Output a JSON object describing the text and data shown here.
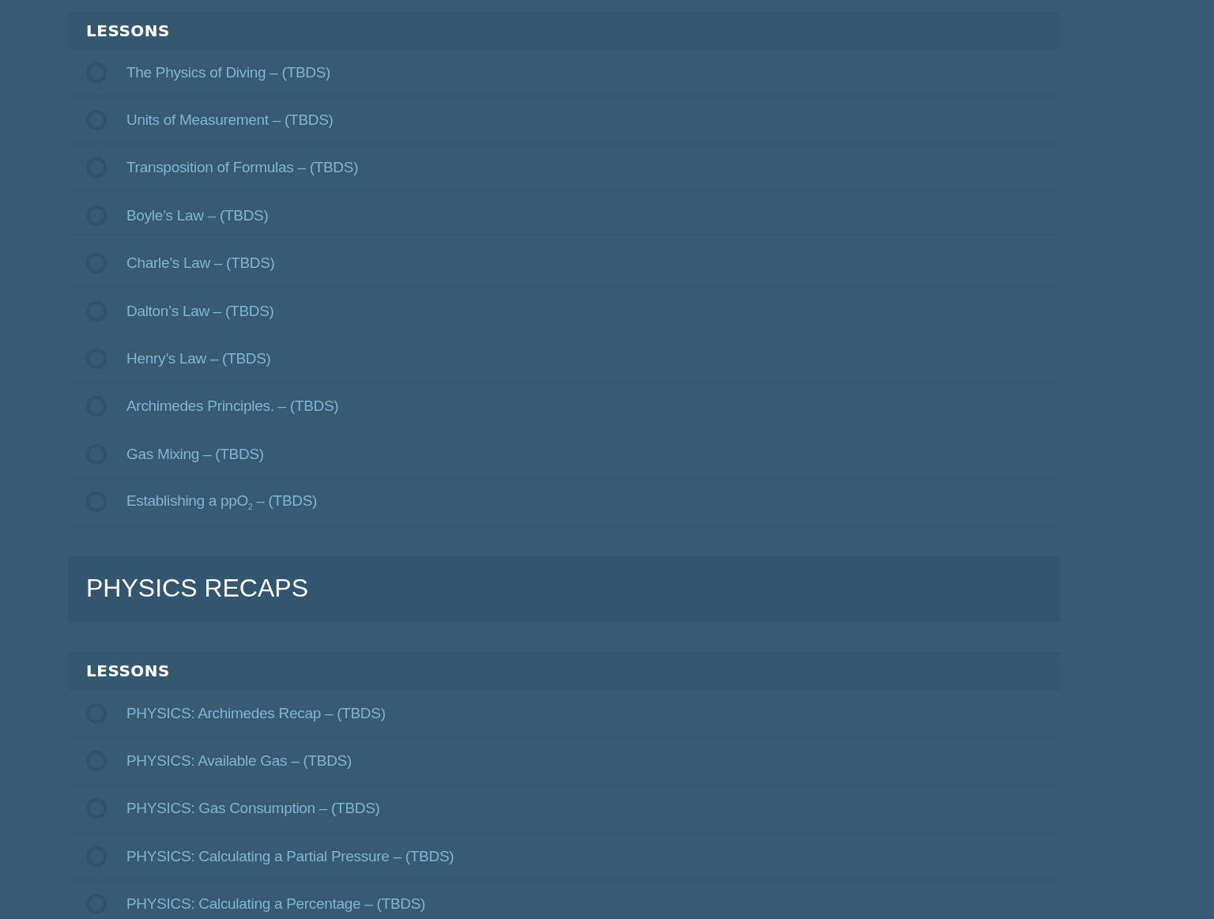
{
  "sections": [
    {
      "heading": "LESSONS",
      "lessons": [
        {
          "title": "The Physics of Diving – (TBDS)",
          "completed": false
        },
        {
          "title": "Units of Measurement – (TBDS)",
          "completed": false
        },
        {
          "title": "Transposition of Formulas – (TBDS)",
          "completed": false
        },
        {
          "title": "Boyle’s Law – (TBDS)",
          "completed": false
        },
        {
          "title": "Charle’s Law – (TBDS)",
          "completed": false
        },
        {
          "title": "Dalton’s Law – (TBDS)",
          "completed": false
        },
        {
          "title": "Henry’s Law – (TBDS)",
          "completed": false
        },
        {
          "title": "Archimedes Principles. – (TBDS)",
          "completed": false
        },
        {
          "title": "Gas Mixing – (TBDS)",
          "completed": false
        },
        {
          "title": "Establishing a ppO$_{2}$ – (TBDS)",
          "completed": false
        }
      ]
    },
    {
      "title": "PHYSICS RECAPS",
      "heading": "LESSONS",
      "lessons": [
        {
          "title": "PHYSICS: Archimedes Recap – (TBDS)",
          "completed": false
        },
        {
          "title": "PHYSICS: Available Gas – (TBDS)",
          "completed": false
        },
        {
          "title": "PHYSICS: Gas Consumption – (TBDS)",
          "completed": false
        },
        {
          "title": "PHYSICS: Calculating a Partial Pressure – (TBDS)",
          "completed": false
        },
        {
          "title": "PHYSICS: Calculating a Percentage – (TBDS)",
          "completed": false
        }
      ]
    }
  ]
}
